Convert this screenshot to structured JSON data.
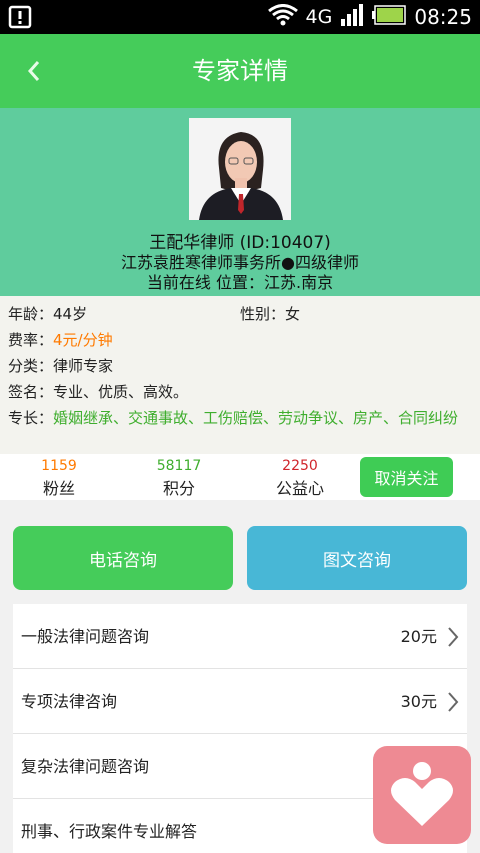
{
  "status_bar": {
    "network": "4G",
    "time": "08:25"
  },
  "header": {
    "back_icon": "chevron-left-icon",
    "title": "专家详情"
  },
  "profile": {
    "name_id": "王配华律师 (ID:10407)",
    "firm_level": "江苏袁胜寒律师事务所●四级律师",
    "online_location": "当前在线 位置：江苏.南京"
  },
  "info": {
    "age_label": "年龄：",
    "age_value": "44岁",
    "gender_label": "性别：",
    "gender_value": "女",
    "rate_label": "费率：",
    "rate_value": "4元/分钟",
    "category_label": "分类：",
    "category_value": "律师专家",
    "signature_label": "签名：",
    "signature_value": "专业、优质、高效。",
    "specialty_label": "专长：",
    "specialty_value": "婚姻继承、交通事故、工伤赔偿、劳动争议、房产、合同纠纷"
  },
  "stats": {
    "fans_count": "1159",
    "fans_label": "粉丝",
    "points_count": "58117",
    "points_label": "积分",
    "charity_count": "2250",
    "charity_label": "公益心",
    "follow_button": "取消关注"
  },
  "consult": {
    "phone_label": "电话咨询",
    "text_label": "图文咨询"
  },
  "services": [
    {
      "name": "一般法律问题咨询",
      "price": "20元"
    },
    {
      "name": "专项法律咨询",
      "price": "30元"
    },
    {
      "name": "复杂法律问题咨询",
      "price": ""
    },
    {
      "name": "刑事、行政案件专业解答",
      "price": ""
    }
  ],
  "colors": {
    "header_green": "#45cc5a",
    "profile_teal": "#5fcc9d",
    "rate_orange": "#ff7a00",
    "specialty_green": "#3fae2e",
    "text_button_blue": "#48b7d6",
    "float_pink": "#ee8a93"
  },
  "floating_icon": "heart-person-icon"
}
